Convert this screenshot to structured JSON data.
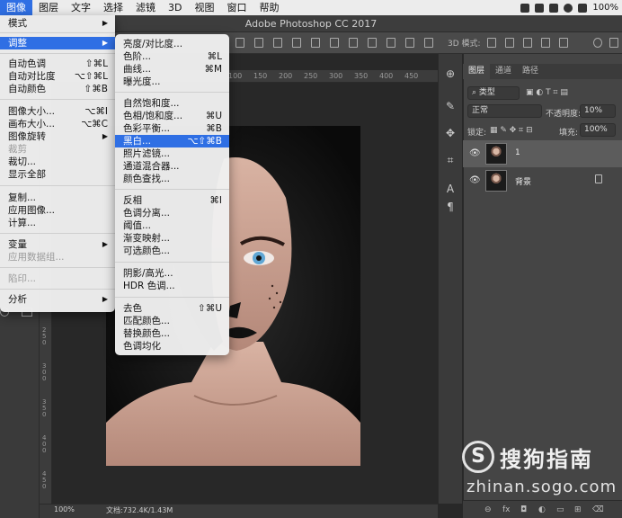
{
  "menubar": {
    "items": [
      "图像",
      "图层",
      "文字",
      "选择",
      "滤镜",
      "3D",
      "视图",
      "窗口",
      "帮助"
    ],
    "battery": "100%"
  },
  "titlebar": {
    "title": "Adobe Photoshop CC 2017"
  },
  "optionsbar": {
    "mode3d": "3D 模式:"
  },
  "rulers": {
    "h_ticks": [
      "100",
      "150",
      "200",
      "250",
      "300",
      "350",
      "400",
      "450",
      "500"
    ],
    "v_ticks": [
      "100",
      "150",
      "200",
      "250",
      "300",
      "350",
      "400",
      "450",
      "500"
    ]
  },
  "statusbar": {
    "zoom": "100%",
    "doc": "文档:732.4K/1.43M"
  },
  "image_menu": {
    "items": [
      {
        "label": "模式",
        "submenu": true
      },
      {
        "label": "调整",
        "submenu": true,
        "highlighted": true
      },
      {
        "label": "自动色调",
        "shortcut": "⇧⌘L"
      },
      {
        "label": "自动对比度",
        "shortcut": "⌥⇧⌘L"
      },
      {
        "label": "自动颜色",
        "shortcut": "⇧⌘B"
      },
      {
        "label": "图像大小...",
        "shortcut": "⌥⌘I"
      },
      {
        "label": "画布大小...",
        "shortcut": "⌥⌘C"
      },
      {
        "label": "图像旋转",
        "submenu": true
      },
      {
        "label": "裁剪",
        "disabled": true
      },
      {
        "label": "裁切..."
      },
      {
        "label": "显示全部"
      },
      {
        "label": "复制..."
      },
      {
        "label": "应用图像..."
      },
      {
        "label": "计算..."
      },
      {
        "label": "变量",
        "submenu": true
      },
      {
        "label": "应用数据组...",
        "disabled": true
      },
      {
        "label": "陷印...",
        "disabled": true
      },
      {
        "label": "分析",
        "submenu": true
      }
    ]
  },
  "adjust_menu": {
    "items": [
      {
        "label": "亮度/对比度..."
      },
      {
        "label": "色阶...",
        "shortcut": "⌘L"
      },
      {
        "label": "曲线...",
        "shortcut": "⌘M"
      },
      {
        "label": "曝光度..."
      },
      {
        "label": "自然饱和度..."
      },
      {
        "label": "色相/饱和度...",
        "shortcut": "⌘U"
      },
      {
        "label": "色彩平衡...",
        "shortcut": "⌘B"
      },
      {
        "label": "黑白...",
        "shortcut": "⌥⇧⌘B",
        "highlighted": true
      },
      {
        "label": "照片滤镜..."
      },
      {
        "label": "通道混合器..."
      },
      {
        "label": "颜色查找..."
      },
      {
        "label": "反相",
        "shortcut": "⌘I"
      },
      {
        "label": "色调分离..."
      },
      {
        "label": "阈值..."
      },
      {
        "label": "渐变映射..."
      },
      {
        "label": "可选颜色..."
      },
      {
        "label": "阴影/高光..."
      },
      {
        "label": "HDR 色调..."
      },
      {
        "label": "去色",
        "shortcut": "⇧⌘U"
      },
      {
        "label": "匹配颜色..."
      },
      {
        "label": "替换颜色..."
      },
      {
        "label": "色调均化"
      }
    ]
  },
  "layers_panel": {
    "tabs": [
      "图层",
      "通道",
      "路径"
    ],
    "filter_kind": "类型",
    "blend_mode": "正常",
    "opacity_label": "不透明度:",
    "opacity_value": "10%",
    "lock_label": "锁定:",
    "fill_label": "填充:",
    "fill_value": "100%",
    "layers": [
      {
        "name": "1",
        "selected": true,
        "visible": true
      },
      {
        "name": "背景",
        "selected": false,
        "visible": true,
        "locked": true
      }
    ],
    "footer": [
      "fx"
    ]
  },
  "watermark": {
    "logo": "S",
    "title": "搜狗指南",
    "url": "zhinan.sogo.com"
  }
}
